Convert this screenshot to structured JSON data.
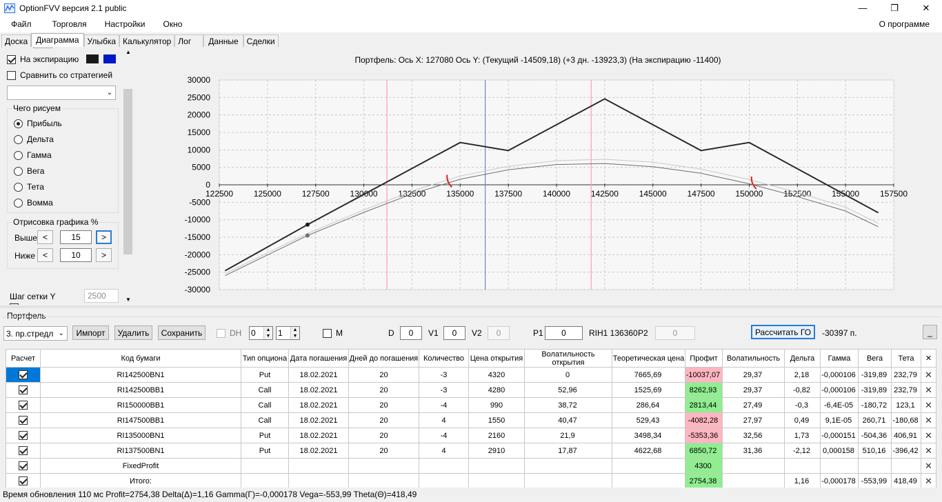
{
  "window": {
    "title": "OptionFVV версия 2.1 public",
    "min": "—",
    "max": "❐",
    "close": "✕"
  },
  "menu": {
    "items": [
      "Файл",
      "Торговля",
      "Настройки",
      "Окно"
    ],
    "about": "О программе"
  },
  "tabs": [
    "Доска",
    "Диаграмма",
    "Улыбка",
    "Калькулятор",
    "Лог",
    "Данные",
    "Сделки"
  ],
  "left": {
    "expiry_label": "На экспирацию",
    "compare_label": "Сравнить со стратегией",
    "draw_group": "Чего рисуем",
    "draw_options": [
      "Прибыль",
      "Дельта",
      "Гамма",
      "Вега",
      "Тета",
      "Вомма"
    ],
    "render_group": "Отрисовка графика %",
    "above_label": "Выше",
    "above_value": "15",
    "below_label": "Ниже",
    "below_value": "10",
    "grid_step_label": "Шаг сетки Y",
    "grid_step_value": "2500",
    "colors": {
      "swatch1": "#1a1a1a",
      "swatch2": "#0018c8"
    }
  },
  "chart_header": "Портфель:  Ось X:  127080  Ось Y:   (Текущий  -14509,18)   (+3 дн.  -13923,3)   (На экспирацию  -11400)",
  "chart_data": {
    "type": "line",
    "x_ticks": [
      "122500",
      "125000",
      "127500",
      "130000",
      "132500",
      "135000",
      "137500",
      "140000",
      "142500",
      "145000",
      "147500",
      "150000",
      "152500",
      "155000",
      "157500"
    ],
    "y_ticks": [
      "30000",
      "25000",
      "20000",
      "15000",
      "10000",
      "5000",
      "0",
      "-5000",
      "-10000",
      "-15000",
      "-20000",
      "-25000",
      "-30000"
    ],
    "xlim": [
      122500,
      157500
    ],
    "ylim": [
      -30000,
      30000
    ],
    "grid": true,
    "series": [
      {
        "color": "#2a2a2a",
        "width": 2,
        "points": [
          [
            122800,
            -24600
          ],
          [
            127080,
            -11400
          ],
          [
            135000,
            12100
          ],
          [
            137500,
            9800
          ],
          [
            142500,
            24600
          ],
          [
            147500,
            9800
          ],
          [
            150000,
            12100
          ],
          [
            156700,
            -8000
          ]
        ]
      },
      {
        "color": "#6e6e6e",
        "width": 1,
        "points": [
          [
            122800,
            -26000
          ],
          [
            127080,
            -14509
          ],
          [
            130000,
            -7900
          ],
          [
            132500,
            -2600
          ],
          [
            135000,
            1600
          ],
          [
            137500,
            4300
          ],
          [
            140000,
            5800
          ],
          [
            142500,
            6100
          ],
          [
            145000,
            5200
          ],
          [
            147500,
            3300
          ],
          [
            150000,
            300
          ],
          [
            152500,
            -3400
          ],
          [
            155000,
            -7500
          ],
          [
            156700,
            -12000
          ]
        ]
      },
      {
        "color": "#c8c8c8",
        "width": 1,
        "points": [
          [
            122800,
            -25400
          ],
          [
            127080,
            -13923
          ],
          [
            130000,
            -7200
          ],
          [
            132500,
            -1800
          ],
          [
            135000,
            2500
          ],
          [
            137500,
            5300
          ],
          [
            140000,
            6900
          ],
          [
            142500,
            7300
          ],
          [
            145000,
            6500
          ],
          [
            147500,
            4500
          ],
          [
            150000,
            1500
          ],
          [
            152500,
            -2200
          ],
          [
            155000,
            -6400
          ],
          [
            156700,
            -11000
          ]
        ]
      }
    ],
    "markers": [
      {
        "x": 127080,
        "y": -11400,
        "color": "#1a1a1a"
      },
      {
        "x": 127080,
        "y": -14509,
        "color": "#707070"
      }
    ],
    "vlines": [
      {
        "x": 131200,
        "color": "#ff9db0"
      },
      {
        "x": 136300,
        "color": "#6a8ac8"
      },
      {
        "x": 141800,
        "color": "#ff9db0"
      }
    ],
    "red_marks": [
      {
        "x": 134500,
        "y": 500
      },
      {
        "x": 150300,
        "y": 0
      }
    ]
  },
  "portfolio": {
    "group_label": "Портфель",
    "selected": "3. пр.стредл",
    "import_label": "Импорт",
    "delete_label": "Удалить",
    "save_label": "Сохранить",
    "dh_label": "DH",
    "spin1": "0",
    "spin2": "1",
    "m_label": "M",
    "d_label": "D",
    "d_value": "0",
    "v1_label": "V1",
    "v1_value": "0",
    "v2_label": "V2",
    "v2_value": "0",
    "p1_label": "P1",
    "p1_value": "0",
    "rih_label": "RIH1 136360",
    "p2_label": "P2",
    "p2_value": "0",
    "calc_label": "Рассчитать ГО",
    "go_value": "-30397 п.",
    "min_label": "_"
  },
  "table": {
    "headers": [
      "Расчет",
      "Код бумаги",
      "Тип опциона",
      "Дата погашения",
      "Дней до погашения",
      "Количество",
      "Цена открытия",
      "Волатильность открытия",
      "Теоретическая цена",
      "Профит",
      "Волатильность",
      "Дельта",
      "Гамма",
      "Вега",
      "Тета",
      "✕"
    ],
    "rows": [
      {
        "code": "RI142500BN1",
        "type": "Put",
        "date": "18.02.2021",
        "days": "20",
        "qty": "-3",
        "price": "4320",
        "vol_open": "0",
        "theor": "7665,69",
        "profit": "-10037,07",
        "pclass": "red",
        "vol": "29,37",
        "delta": "2,18",
        "gamma": "-0,000106",
        "vega": "-319,89",
        "theta": "232,79",
        "sel": true
      },
      {
        "code": "RI142500BB1",
        "type": "Call",
        "date": "18.02.2021",
        "days": "20",
        "qty": "-3",
        "price": "4280",
        "vol_open": "52,96",
        "theor": "1525,69",
        "profit": "8262,93",
        "pclass": "green",
        "vol": "29,37",
        "delta": "-0,82",
        "gamma": "-0,000106",
        "vega": "-319,89",
        "theta": "232,79"
      },
      {
        "code": "RI150000BB1",
        "type": "Call",
        "date": "18.02.2021",
        "days": "20",
        "qty": "-4",
        "price": "990",
        "vol_open": "38,72",
        "theor": "286,64",
        "profit": "2813,44",
        "pclass": "green",
        "vol": "27,49",
        "delta": "-0,3",
        "gamma": "-6,4E-05",
        "vega": "-180,72",
        "theta": "123,1"
      },
      {
        "code": "RI147500BB1",
        "type": "Call",
        "date": "18.02.2021",
        "days": "20",
        "qty": "4",
        "price": "1550",
        "vol_open": "40,47",
        "theor": "529,43",
        "profit": "-4082,28",
        "pclass": "red",
        "vol": "27,97",
        "delta": "0,49",
        "gamma": "9,1E-05",
        "vega": "260,71",
        "theta": "-180,68"
      },
      {
        "code": "RI135000BN1",
        "type": "Put",
        "date": "18.02.2021",
        "days": "20",
        "qty": "-4",
        "price": "2160",
        "vol_open": "21,9",
        "theor": "3498,34",
        "profit": "-5353,36",
        "pclass": "red",
        "vol": "32,56",
        "delta": "1,73",
        "gamma": "-0,000151",
        "vega": "-504,36",
        "theta": "406,91"
      },
      {
        "code": "RI137500BN1",
        "type": "Put",
        "date": "18.02.2021",
        "days": "20",
        "qty": "4",
        "price": "2910",
        "vol_open": "17,87",
        "theor": "4622,68",
        "profit": "6850,72",
        "pclass": "green",
        "vol": "31,36",
        "delta": "-2,12",
        "gamma": "0,000158",
        "vega": "510,16",
        "theta": "-396,42"
      },
      {
        "code": "FixedProfit",
        "type": "",
        "date": "",
        "days": "",
        "qty": "",
        "price": "",
        "vol_open": "",
        "theor": "",
        "profit": "4300",
        "pclass": "green",
        "vol": "",
        "delta": "",
        "gamma": "",
        "vega": "",
        "theta": ""
      },
      {
        "code": "Итого:",
        "type": "",
        "date": "",
        "days": "",
        "qty": "",
        "price": "",
        "vol_open": "",
        "theor": "",
        "profit": "2754,38",
        "pclass": "green",
        "vol": "",
        "delta": "1,16",
        "gamma": "-0,000178",
        "vega": "-553,99",
        "theta": "418,49"
      }
    ]
  },
  "status": "Время обновления 110 мс   Profit=2754,38 Delta(Δ)=1,16 Gamma(Γ)=-0,000178 Vega=-553,99 Theta(Θ)=418,49"
}
